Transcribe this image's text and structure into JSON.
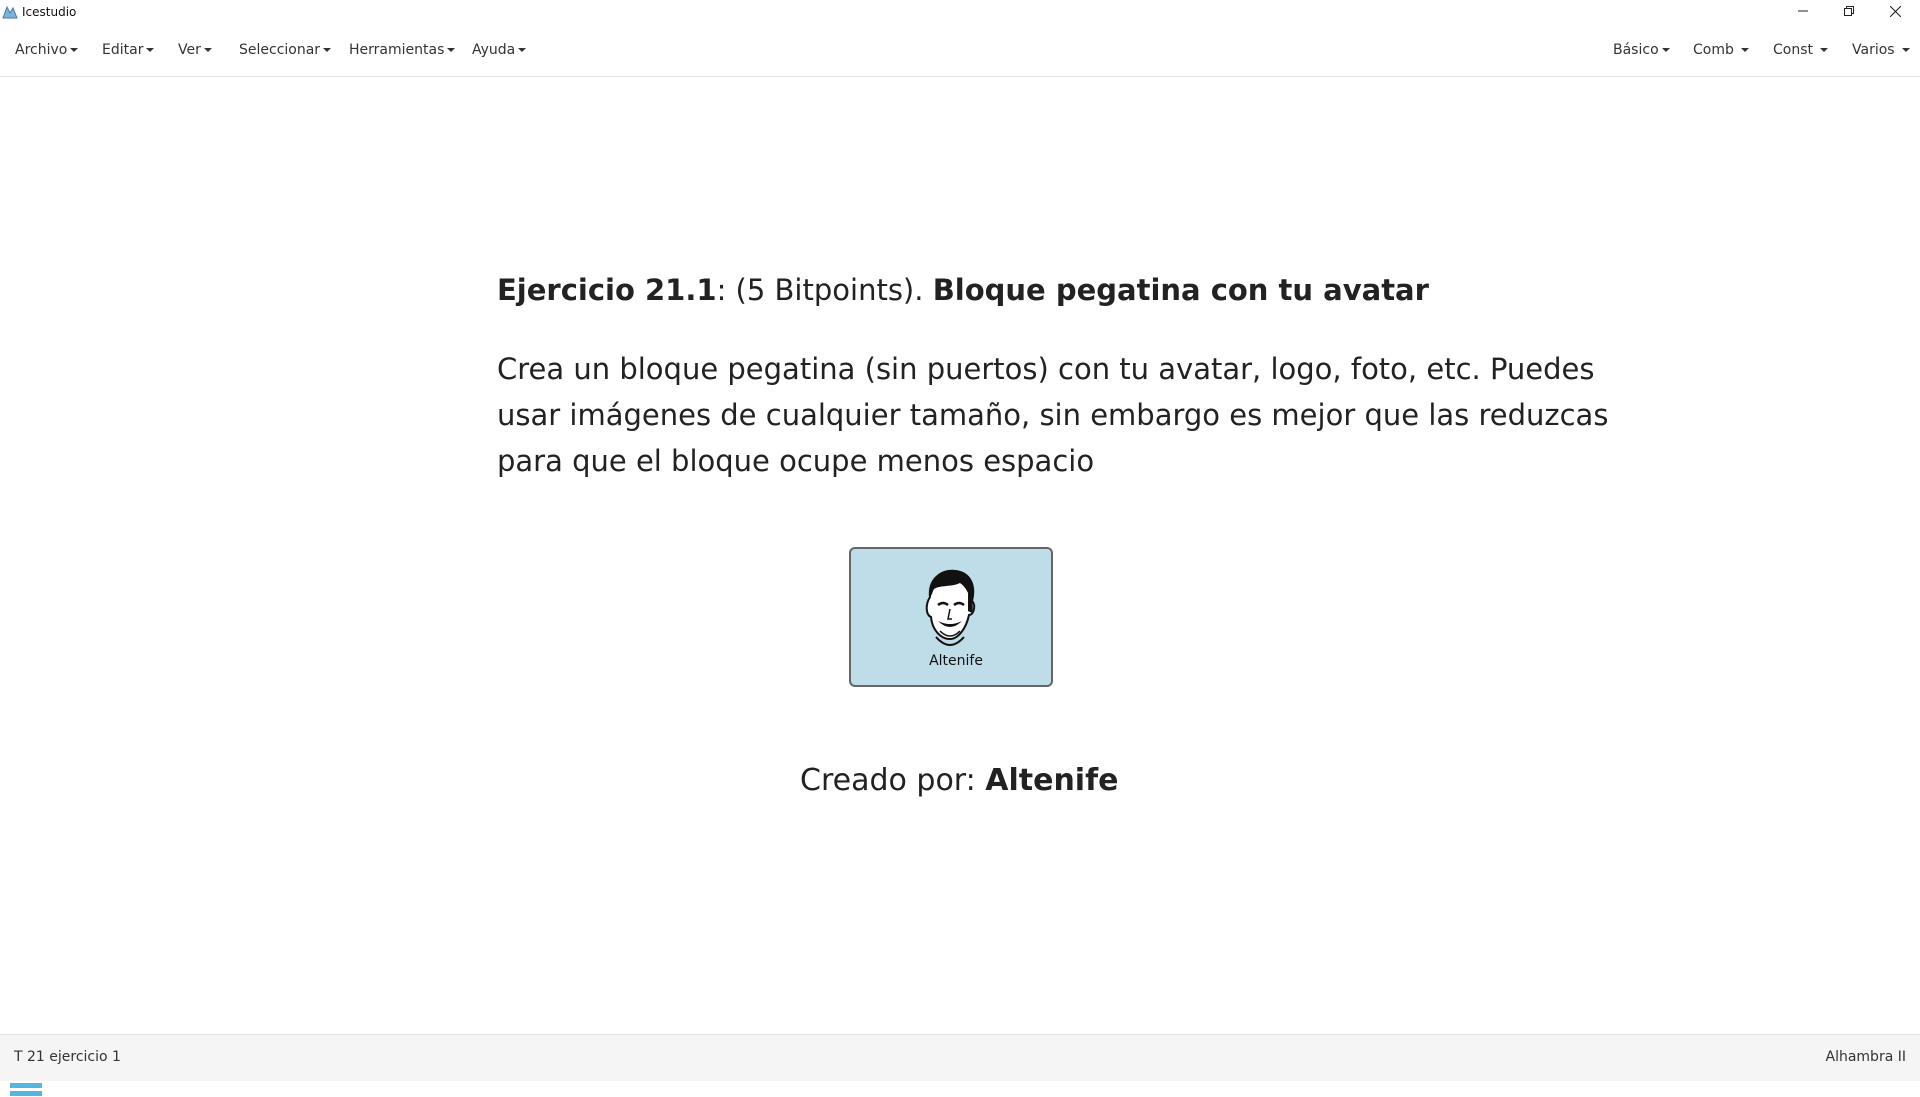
{
  "window": {
    "title": "Icestudio"
  },
  "menu_left": [
    {
      "label": "Archivo"
    },
    {
      "label": "Editar"
    },
    {
      "label": "Ver"
    },
    {
      "label": "Seleccionar"
    },
    {
      "label": "Herramientas"
    },
    {
      "label": "Ayuda"
    }
  ],
  "menu_right": [
    {
      "label": "Básico"
    },
    {
      "label": "Comb"
    },
    {
      "label": "Const"
    },
    {
      "label": "Varios"
    }
  ],
  "content": {
    "heading_bold1": "Ejercicio 21.1",
    "heading_mid": ": (5 Bitpoints). ",
    "heading_bold2": "Bloque pegatina con tu avatar",
    "paragraph_lines": [
      "Crea un bloque pegatina (sin puertos) con tu avatar, logo, foto, etc. Puedes",
      "usar imágenes de cualquier tamaño, sin embargo es mejor que las reduzcas",
      "para que el bloque ocupe menos espacio"
    ],
    "block_label": "Altenife",
    "credit_prefix": "Creado por: ",
    "credit_name": "Altenife"
  },
  "footer": {
    "project_name": "T 21 ejercicio 1",
    "board": "Alhambra II"
  },
  "colors": {
    "block_bg": "#bfdde8",
    "hamburger": "#55b6e2",
    "footer_bg": "#f5f5f5"
  }
}
